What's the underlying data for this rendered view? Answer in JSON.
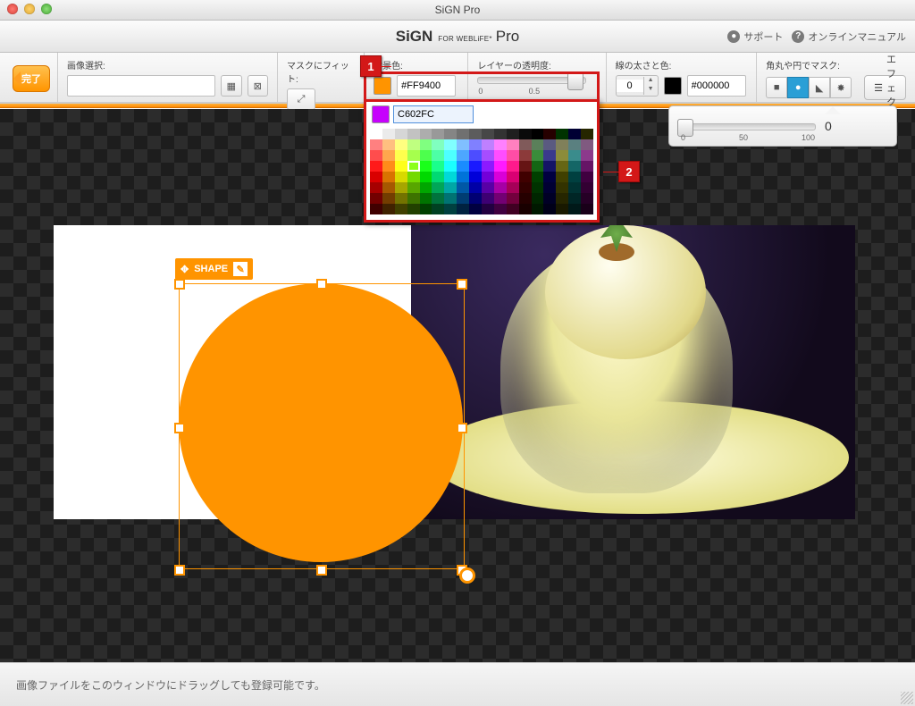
{
  "window": {
    "title": "SiGN Pro"
  },
  "brand": {
    "name": "SiGN",
    "tag": "FOR WEBLiFE*",
    "edition": "Pro"
  },
  "header_links": {
    "support": "サポート",
    "manual": "オンラインマニュアル"
  },
  "toolbar": {
    "done": "完了",
    "image_select_label": "画像選択:",
    "fit_mask_label": "マスクにフィット:",
    "bgcolor_label": "背景色:",
    "bgcolor_value": "#FF9400",
    "opacity_label": "レイヤーの透明度:",
    "opacity_ticks": {
      "min": "0",
      "mid": "0.5",
      "max": ""
    },
    "stroke_label": "線の太さと色:",
    "stroke_width": "0",
    "stroke_color": "#000000",
    "mask_shape_label": "角丸や円でマスク:",
    "effect": "エフェクト"
  },
  "corner_slider": {
    "t0": "0",
    "t1": "50",
    "t2": "100",
    "value": "0"
  },
  "color_picker": {
    "hex": "C602FC"
  },
  "shape_tag": "SHAPE",
  "callouts": {
    "one": "1",
    "two": "2"
  },
  "footer": "画像ファイルをこのウィンドウにドラッグしても登録可能です。",
  "palette": [
    "#ffffff",
    "#ebebeb",
    "#d6d6d6",
    "#c2c2c2",
    "#adadad",
    "#999999",
    "#858585",
    "#707070",
    "#5c5c5c",
    "#474747",
    "#333333",
    "#1f1f1f",
    "#0a0a0a",
    "#000000",
    "#260000",
    "#003300",
    "#000033",
    "#262600",
    "#ff8080",
    "#ffbf80",
    "#ffff80",
    "#bfff80",
    "#80ff80",
    "#80ffbf",
    "#80ffff",
    "#80bfff",
    "#8080ff",
    "#bf80ff",
    "#ff80ff",
    "#ff80bf",
    "#805a5a",
    "#5a805a",
    "#5a5a80",
    "#80805a",
    "#5a8080",
    "#805a80",
    "#ff4d4d",
    "#ffa64d",
    "#ffff4d",
    "#a6ff4d",
    "#4dff4d",
    "#4dffa6",
    "#4dffff",
    "#4da6ff",
    "#4d4dff",
    "#a64dff",
    "#ff4dff",
    "#ff4da6",
    "#8c3a3a",
    "#3a8c3a",
    "#3a3a8c",
    "#8c8c3a",
    "#3a8c8c",
    "#8c3a8c",
    "#ff1a1a",
    "#ff8c1a",
    "#ffff1a",
    "#8cff1a",
    "#1aff1a",
    "#1aff8c",
    "#1affff",
    "#1a8cff",
    "#1a1aff",
    "#8c1aff",
    "#ff1aff",
    "#ff1a8c",
    "#661414",
    "#146614",
    "#141466",
    "#666614",
    "#146666",
    "#661466",
    "#d90000",
    "#d97300",
    "#d9d900",
    "#73d900",
    "#00d900",
    "#00d973",
    "#00d9d9",
    "#0073d9",
    "#0000d9",
    "#7300d9",
    "#d900d9",
    "#d90073",
    "#400000",
    "#004000",
    "#000040",
    "#404000",
    "#004040",
    "#400040",
    "#a60000",
    "#a65800",
    "#a6a600",
    "#58a600",
    "#00a600",
    "#00a658",
    "#00a6a6",
    "#0058a6",
    "#0000a6",
    "#5800a6",
    "#a600a6",
    "#a60058",
    "#330000",
    "#003300",
    "#000033",
    "#333300",
    "#003333",
    "#330033",
    "#730000",
    "#733d00",
    "#737300",
    "#3d7300",
    "#007300",
    "#00733d",
    "#007373",
    "#003d73",
    "#000073",
    "#3d0073",
    "#730073",
    "#73003d",
    "#260000",
    "#002600",
    "#000026",
    "#262600",
    "#002626",
    "#260026",
    "#400000",
    "#402200",
    "#404000",
    "#224000",
    "#004000",
    "#004022",
    "#004040",
    "#002240",
    "#000040",
    "#220040",
    "#400040",
    "#400022",
    "#190000",
    "#001900",
    "#000019",
    "#191900",
    "#001919",
    "#190019"
  ],
  "palette_sel_index": 57
}
